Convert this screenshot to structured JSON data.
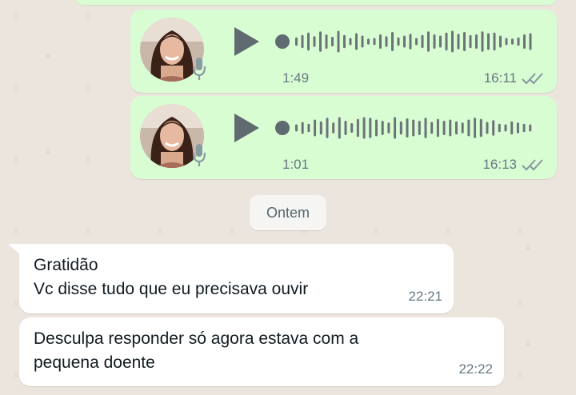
{
  "colors": {
    "outgoing_bubble": "#d9fdd3",
    "incoming_bubble": "#ffffff",
    "chat_background": "#ece5dd",
    "meta_text": "#667781",
    "waveform": "#6b7278"
  },
  "voice_messages": [
    {
      "duration": "1:49",
      "time": "16:11",
      "status_icon": "double-check-icon",
      "waveform": [
        0.35,
        0.55,
        0.75,
        0.45,
        0.85,
        0.6,
        0.4,
        0.9,
        0.55,
        0.3,
        0.7,
        0.5,
        0.25,
        0.3,
        0.6,
        0.45,
        0.8,
        0.35,
        0.5,
        0.65,
        0.3,
        0.55,
        0.85,
        0.6,
        0.5,
        0.75,
        0.9,
        0.65,
        0.8,
        0.55,
        0.6,
        0.85,
        0.7,
        0.75,
        0.5,
        0.3,
        0.25,
        0.35,
        0.6,
        0.7
      ]
    },
    {
      "duration": "1:01",
      "time": "16:13",
      "status_icon": "double-check-icon",
      "waveform": [
        0.3,
        0.5,
        0.35,
        0.7,
        0.55,
        0.85,
        0.45,
        0.9,
        0.6,
        0.4,
        0.75,
        0.9,
        0.85,
        0.7,
        0.6,
        0.45,
        0.9,
        0.55,
        0.8,
        0.7,
        0.6,
        0.85,
        0.5,
        0.75,
        0.6,
        0.7,
        0.55,
        0.45,
        0.7,
        0.85,
        0.75,
        0.5,
        0.65,
        0.35,
        0.3,
        0.55,
        0.45,
        0.35,
        0.3
      ]
    }
  ],
  "date_divider": "Ontem",
  "incoming_messages": [
    {
      "text": "Gratidão\nVc disse tudo que eu precisava ouvir",
      "time": "22:21"
    },
    {
      "text": "Desculpa responder só agora estava com a\npequena doente",
      "time": "22:22"
    }
  ]
}
